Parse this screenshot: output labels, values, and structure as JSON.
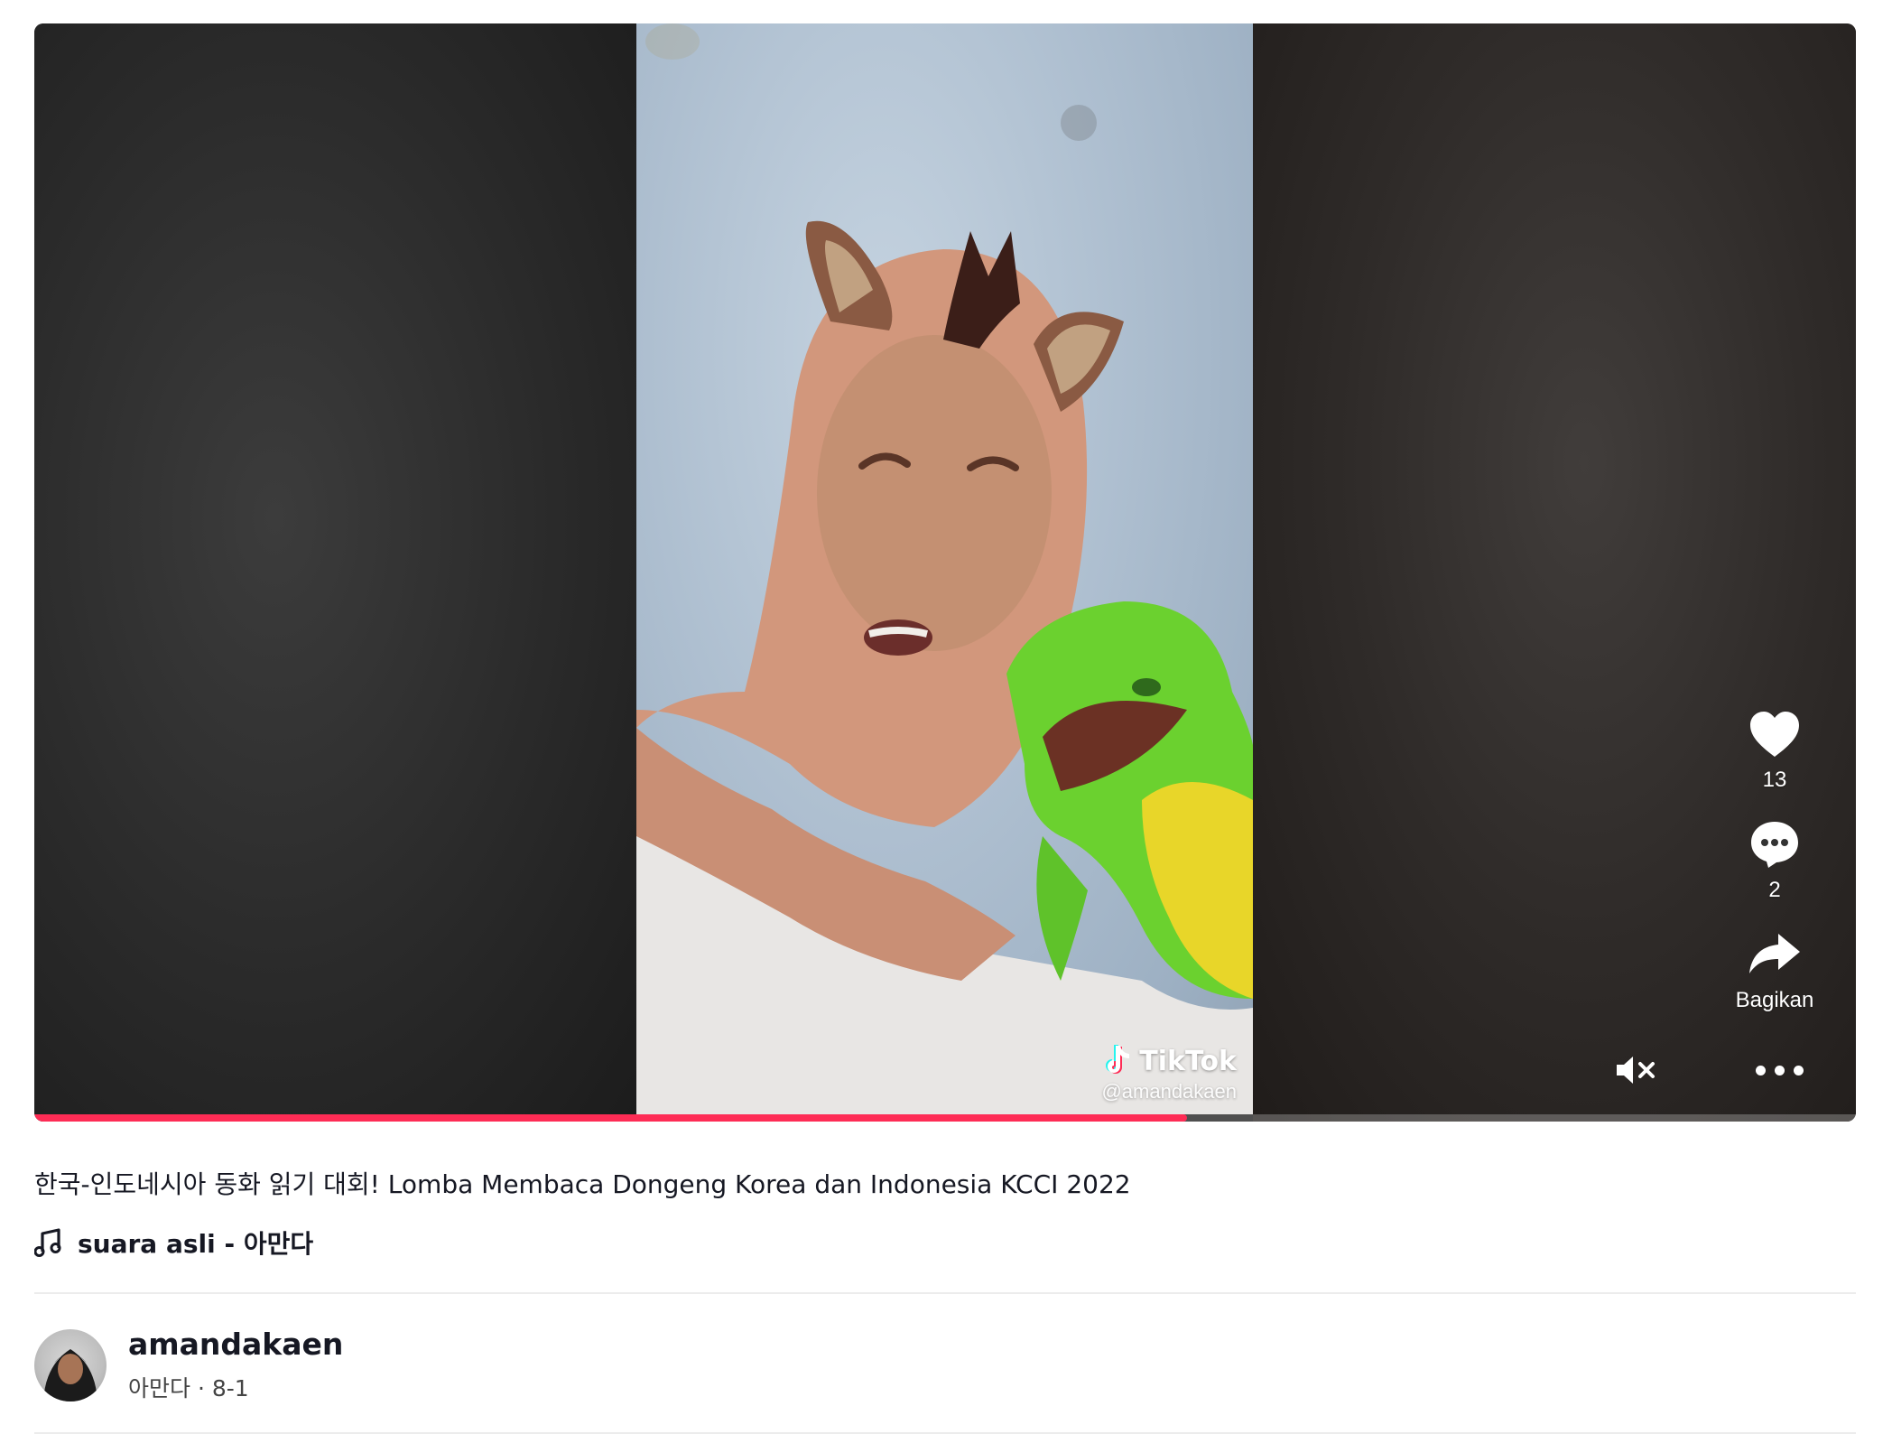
{
  "video": {
    "watermark_brand": "TikTok",
    "watermark_handle": "@amandakaen",
    "progress": 0.633,
    "accent_color": "#fe2c55"
  },
  "actions": {
    "like_icon": "heart-icon",
    "like_count": "13",
    "comment_icon": "comment-icon",
    "comment_count": "2",
    "share_icon": "share-arrow-icon",
    "share_label": "Bagikan",
    "mute_icon": "speaker-muted-icon",
    "more_icon": "more-dots-icon"
  },
  "post": {
    "caption": "한국-인도네시아 동화 읽기 대회! Lomba Membaca Dongeng Korea dan Indonesia KCCI 2022",
    "music_icon": "music-note-icon",
    "sound": "suara asli - 아만다"
  },
  "author": {
    "username": "amandakaen",
    "nickname": "아만다",
    "separator": "·",
    "date": "8-1"
  }
}
